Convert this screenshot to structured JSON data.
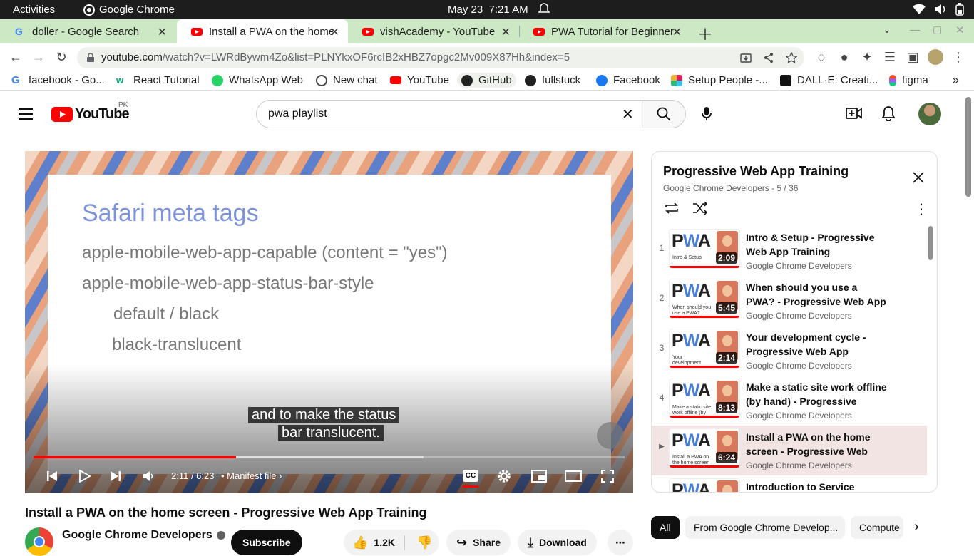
{
  "system_bar": {
    "activities": "Activities",
    "app_name": "Google Chrome",
    "date": "May 23",
    "time": "7:21 AM"
  },
  "tabs": [
    {
      "title": "doller - Google Search",
      "favicon": "google-icon"
    },
    {
      "title": "Install a PWA on the home screen",
      "favicon": "youtube-icon"
    },
    {
      "title": "vishAcademy - YouTube",
      "favicon": "youtube-icon"
    },
    {
      "title": "PWA Tutorial for Beginners",
      "favicon": "youtube-icon"
    }
  ],
  "address_bar": {
    "domain": "youtube.com",
    "path": "/watch?v=LWRdBywm4Zo&list=PLNYkxOF6rcIB2xHBZ7opgc2Mv009X87Hh&index=5"
  },
  "bookmarks": [
    {
      "label": "facebook - Go...",
      "icon": "google-icon"
    },
    {
      "label": "React Tutorial",
      "icon": "w3schools-icon"
    },
    {
      "label": "WhatsApp Web",
      "icon": "whatsapp-icon"
    },
    {
      "label": "New chat",
      "icon": "openai-icon"
    },
    {
      "label": "YouTube",
      "icon": "youtube-icon"
    },
    {
      "label": "GitHub",
      "icon": "github-icon"
    },
    {
      "label": "fullstuck",
      "icon": "github-icon"
    },
    {
      "label": "Facebook",
      "icon": "facebook-icon"
    },
    {
      "label": "Setup People -...",
      "icon": "slack-icon"
    },
    {
      "label": "DALL·E: Creati...",
      "icon": "openai-icon"
    },
    {
      "label": "figma",
      "icon": "figma-icon"
    }
  ],
  "header": {
    "logo_text": "YouTube",
    "country": "PK",
    "search_value": "pwa playlist"
  },
  "video": {
    "slide_title": "Safari meta tags",
    "slide_lines": [
      "apple-mobile-web-app-capable (content = \"yes\")",
      "apple-mobile-web-app-status-bar-style",
      "default / black",
      "black-translucent"
    ],
    "caption_line1": "and to make the status",
    "caption_line2": "bar translucent.",
    "time_display": "2:11 / 6:23",
    "chapter": "• Manifest file",
    "progress": 0.343,
    "buffered": 0.66
  },
  "video_title": "Install a PWA on the home screen - Progressive Web App Training",
  "channel": {
    "name": "Google Chrome Developers",
    "subscribe": "Subscribe"
  },
  "actions": {
    "likes": "1.2K",
    "share": "Share",
    "download": "Download"
  },
  "playlist": {
    "title": "Progressive Web App Training",
    "meta": "Google Chrome Developers - 5 / 36",
    "items": [
      {
        "index": "1",
        "title": "Intro & Setup - Progressive Web App Training",
        "channel": "Google Chrome Developers",
        "duration": "2:09",
        "thumb_text": "Intro & Setup"
      },
      {
        "index": "2",
        "title": "When should you use a PWA? - Progressive Web App Training",
        "channel": "Google Chrome Developers",
        "duration": "5:45",
        "thumb_text": "When should you use a PWA?"
      },
      {
        "index": "3",
        "title": "Your development cycle - Progressive Web App Training",
        "channel": "Google Chrome Developers",
        "duration": "2:14",
        "thumb_text": "Your development cycle"
      },
      {
        "index": "4",
        "title": "Make a static site work offline (by hand) - Progressive Web…",
        "channel": "Google Chrome Developers",
        "duration": "8:13",
        "thumb_text": "Make a static site work offline (by hand)"
      },
      {
        "index": "▶",
        "title": "Install a PWA on the home screen - Progressive Web Ap…",
        "channel": "Google Chrome Developers",
        "duration": "6:24",
        "thumb_text": "Install a PWA on the home screen"
      },
      {
        "index": "",
        "title": "Introduction to Service Worker",
        "channel": "",
        "duration": "",
        "thumb_text": ""
      }
    ]
  },
  "chips": [
    "All",
    "From Google Chrome Develop...",
    "Compute"
  ]
}
